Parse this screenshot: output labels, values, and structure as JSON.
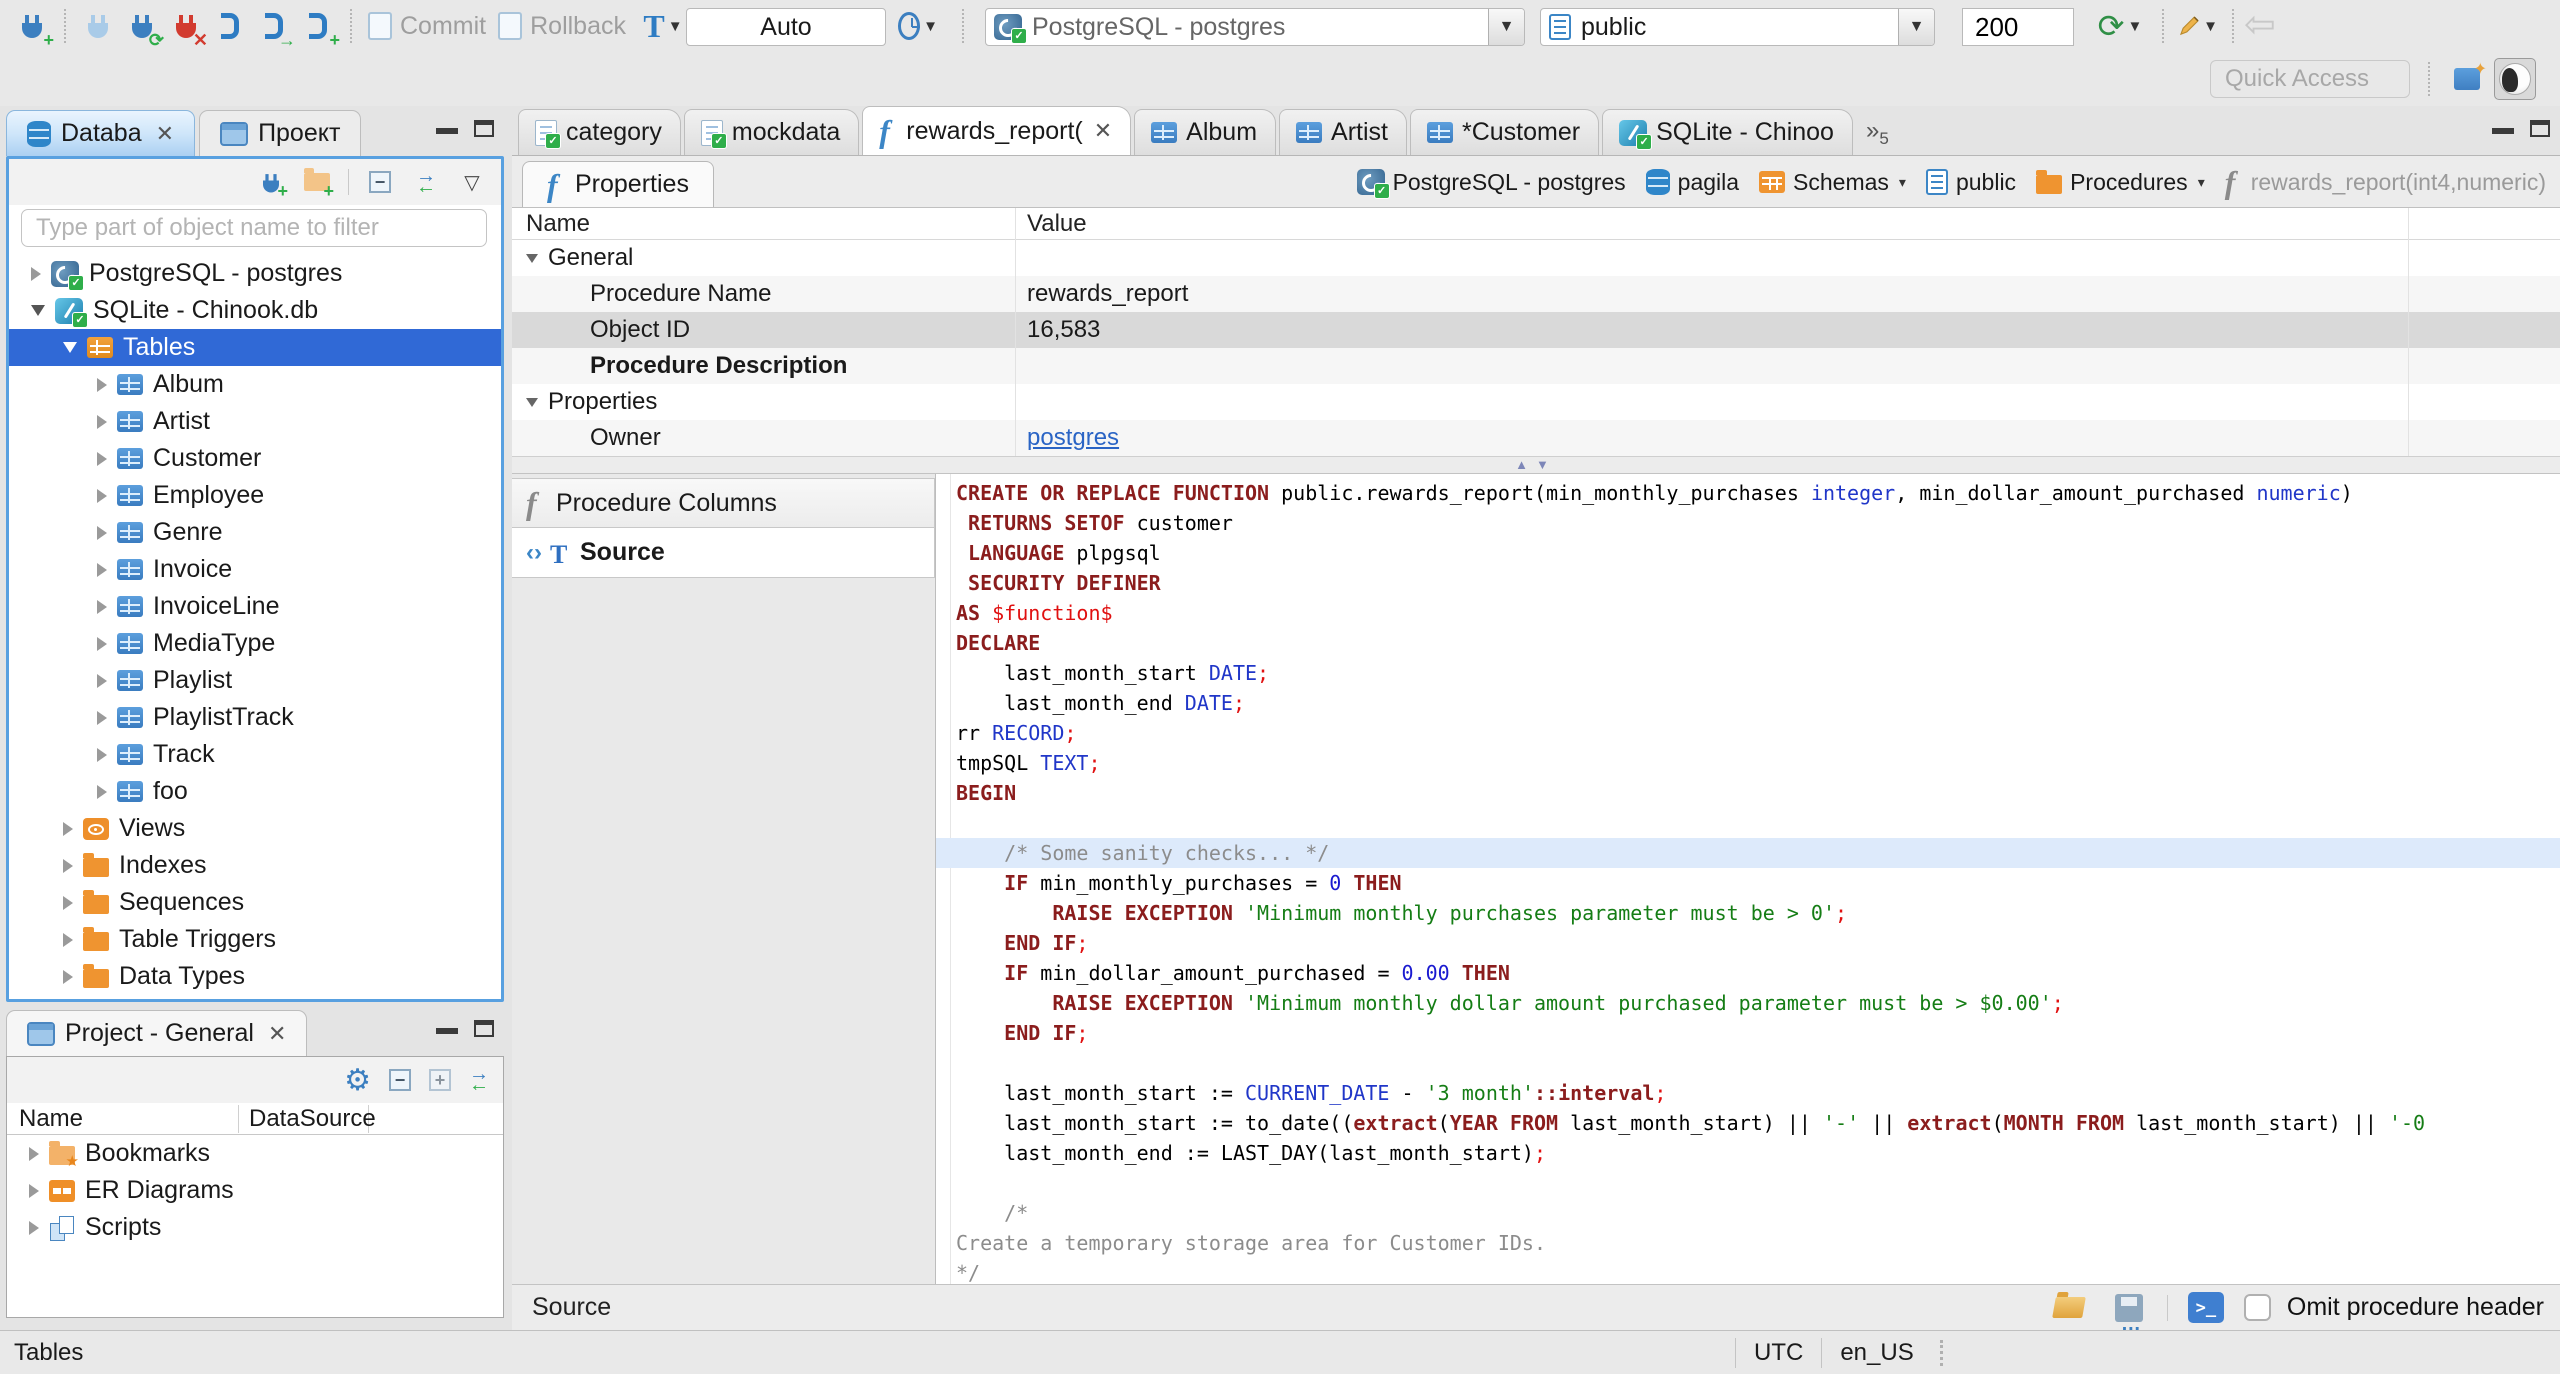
{
  "toolbar": {
    "commit": "Commit",
    "rollback": "Rollback",
    "auto_commit": "Auto",
    "connection": "PostgreSQL - postgres",
    "schema": "public",
    "fetch_size": "200",
    "quick_access_placeholder": "Quick Access"
  },
  "navigator": {
    "tab_database": "Databa",
    "tab_project": "Проект",
    "filter_placeholder": "Type part of object name to filter",
    "tree": [
      {
        "label": "PostgreSQL - postgres",
        "depth": 0,
        "icon": "postgres",
        "state": "collapsed"
      },
      {
        "label": "SQLite - Chinook.db",
        "depth": 0,
        "icon": "sqlite",
        "state": "expanded"
      },
      {
        "label": "Tables",
        "depth": 1,
        "icon": "tables",
        "state": "expanded",
        "selected": true
      },
      {
        "label": "Album",
        "depth": 2,
        "icon": "table",
        "state": "collapsed"
      },
      {
        "label": "Artist",
        "depth": 2,
        "icon": "table",
        "state": "collapsed"
      },
      {
        "label": "Customer",
        "depth": 2,
        "icon": "table",
        "state": "collapsed"
      },
      {
        "label": "Employee",
        "depth": 2,
        "icon": "table",
        "state": "collapsed"
      },
      {
        "label": "Genre",
        "depth": 2,
        "icon": "table",
        "state": "collapsed"
      },
      {
        "label": "Invoice",
        "depth": 2,
        "icon": "table",
        "state": "collapsed"
      },
      {
        "label": "InvoiceLine",
        "depth": 2,
        "icon": "table",
        "state": "collapsed"
      },
      {
        "label": "MediaType",
        "depth": 2,
        "icon": "table",
        "state": "collapsed"
      },
      {
        "label": "Playlist",
        "depth": 2,
        "icon": "table",
        "state": "collapsed"
      },
      {
        "label": "PlaylistTrack",
        "depth": 2,
        "icon": "table",
        "state": "collapsed"
      },
      {
        "label": "Track",
        "depth": 2,
        "icon": "table",
        "state": "collapsed"
      },
      {
        "label": "foo",
        "depth": 2,
        "icon": "table",
        "state": "collapsed"
      },
      {
        "label": "Views",
        "depth": 1,
        "icon": "views",
        "state": "collapsed"
      },
      {
        "label": "Indexes",
        "depth": 1,
        "icon": "folder",
        "state": "collapsed"
      },
      {
        "label": "Sequences",
        "depth": 1,
        "icon": "folder",
        "state": "collapsed"
      },
      {
        "label": "Table Triggers",
        "depth": 1,
        "icon": "folder",
        "state": "collapsed"
      },
      {
        "label": "Data Types",
        "depth": 1,
        "icon": "folder",
        "state": "collapsed"
      }
    ]
  },
  "project_panel": {
    "title": "Project - General",
    "columns": [
      "Name",
      "DataSource"
    ],
    "items": [
      {
        "label": "Bookmarks",
        "icon": "bookmarks"
      },
      {
        "label": "ER Diagrams",
        "icon": "erd"
      },
      {
        "label": "Scripts",
        "icon": "scripts"
      }
    ]
  },
  "editor_tabs": [
    {
      "label": "category",
      "icon": "script"
    },
    {
      "label": "mockdata",
      "icon": "script"
    },
    {
      "label": "rewards_report(",
      "icon": "func",
      "active": true,
      "closable": true
    },
    {
      "label": "Album",
      "icon": "table"
    },
    {
      "label": "Artist",
      "icon": "table"
    },
    {
      "label": "*Customer",
      "icon": "table"
    },
    {
      "label": "SQLite - Chinoo",
      "icon": "sqlite"
    }
  ],
  "editor_tabs_overflow": "5",
  "properties_view": {
    "tab": "Properties",
    "columns": [
      "Name",
      "Value"
    ],
    "rows": [
      {
        "name": "General",
        "group": true
      },
      {
        "name": "Procedure Name",
        "value": "rewards_report"
      },
      {
        "name": "Object ID",
        "value": "16,583",
        "selected": true
      },
      {
        "name": "Procedure Description",
        "value": "",
        "bold": true
      },
      {
        "name": "Properties",
        "group": true
      },
      {
        "name": "Owner",
        "value": "postgres",
        "link": true
      }
    ]
  },
  "breadcrumb": [
    {
      "label": "PostgreSQL - postgres",
      "icon": "postgres"
    },
    {
      "label": "pagila",
      "icon": "database"
    },
    {
      "label": "Schemas",
      "icon": "schemas",
      "dropdown": true
    },
    {
      "label": "public",
      "icon": "schema"
    },
    {
      "label": "Procedures",
      "icon": "folder",
      "dropdown": true
    },
    {
      "label": "rewards_report(int4,numeric)",
      "icon": "func",
      "muted": true
    }
  ],
  "subtabs": [
    {
      "label": "Procedure Columns",
      "icon": "func"
    },
    {
      "label": "Source",
      "icon": "source",
      "active": true
    }
  ],
  "source_viewer": {
    "highlight_line": 12,
    "lines": [
      [
        [
          "k",
          "CREATE OR REPLACE FUNCTION"
        ],
        [
          "p",
          " public.rewards_report(min_monthly_purchases "
        ],
        [
          "t",
          "integer"
        ],
        [
          "p",
          ", min_dollar_amount_purchased "
        ],
        [
          "t",
          "numeric"
        ],
        [
          "p",
          ")"
        ]
      ],
      [
        [
          "k",
          " RETURNS SETOF"
        ],
        [
          "p",
          " customer"
        ]
      ],
      [
        [
          "k",
          " LANGUAGE"
        ],
        [
          "p",
          " plpgsql"
        ]
      ],
      [
        [
          "k",
          " SECURITY DEFINER"
        ]
      ],
      [
        [
          "k",
          "AS "
        ],
        [
          "r",
          "$function$"
        ]
      ],
      [
        [
          "k",
          "DECLARE"
        ]
      ],
      [
        [
          "p",
          "    last_month_start "
        ],
        [
          "t",
          "DATE"
        ],
        [
          "r",
          ";"
        ]
      ],
      [
        [
          "p",
          "    last_month_end "
        ],
        [
          "t",
          "DATE"
        ],
        [
          "r",
          ";"
        ]
      ],
      [
        [
          "p",
          "rr "
        ],
        [
          "t",
          "RECORD"
        ],
        [
          "r",
          ";"
        ]
      ],
      [
        [
          "p",
          "tmpSQL "
        ],
        [
          "t",
          "TEXT"
        ],
        [
          "r",
          ";"
        ]
      ],
      [
        [
          "k",
          "BEGIN"
        ]
      ],
      [],
      [
        [
          "c",
          "    /* Some sanity checks... */"
        ]
      ],
      [
        [
          "k",
          "    IF"
        ],
        [
          "p",
          " min_monthly_purchases = "
        ],
        [
          "n",
          "0"
        ],
        [
          "k",
          " THEN"
        ]
      ],
      [
        [
          "k",
          "        RAISE EXCEPTION "
        ],
        [
          "s",
          "'Minimum monthly purchases parameter must be > 0'"
        ],
        [
          "r",
          ";"
        ]
      ],
      [
        [
          "k",
          "    END IF"
        ],
        [
          "r",
          ";"
        ]
      ],
      [
        [
          "k",
          "    IF"
        ],
        [
          "p",
          " min_dollar_amount_purchased = "
        ],
        [
          "n",
          "0.00"
        ],
        [
          "k",
          " THEN"
        ]
      ],
      [
        [
          "k",
          "        RAISE EXCEPTION "
        ],
        [
          "s",
          "'Minimum monthly dollar amount purchased parameter must be > $0.00'"
        ],
        [
          "r",
          ";"
        ]
      ],
      [
        [
          "k",
          "    END IF"
        ],
        [
          "r",
          ";"
        ]
      ],
      [],
      [
        [
          "p",
          "    last_month_start := "
        ],
        [
          "t",
          "CURRENT_DATE"
        ],
        [
          "p",
          " - "
        ],
        [
          "s",
          "'3 month'"
        ],
        [
          "k",
          "::interval"
        ],
        [
          "r",
          ";"
        ]
      ],
      [
        [
          "p",
          "    last_month_start := to_date(("
        ],
        [
          "k",
          "extract"
        ],
        [
          "p",
          "("
        ],
        [
          "k",
          "YEAR FROM"
        ],
        [
          "p",
          " last_month_start) || "
        ],
        [
          "s",
          "'-'"
        ],
        [
          "p",
          " || "
        ],
        [
          "k",
          "extract"
        ],
        [
          "p",
          "("
        ],
        [
          "k",
          "MONTH FROM"
        ],
        [
          "p",
          " last_month_start) || "
        ],
        [
          "s",
          "'-0"
        ]
      ],
      [
        [
          "p",
          "    last_month_end := LAST_DAY(last_month_start)"
        ],
        [
          "r",
          ";"
        ]
      ],
      [],
      [
        [
          "c",
          "    /*"
        ]
      ],
      [
        [
          "c",
          "Create a temporary storage area for Customer IDs."
        ]
      ],
      [
        [
          "c",
          "*/"
        ]
      ]
    ]
  },
  "editor_status": {
    "label": "Source",
    "omit_checkbox_label": "Omit procedure header"
  },
  "status_bar": {
    "context": "Tables",
    "timezone": "UTC",
    "locale": "en_US"
  }
}
